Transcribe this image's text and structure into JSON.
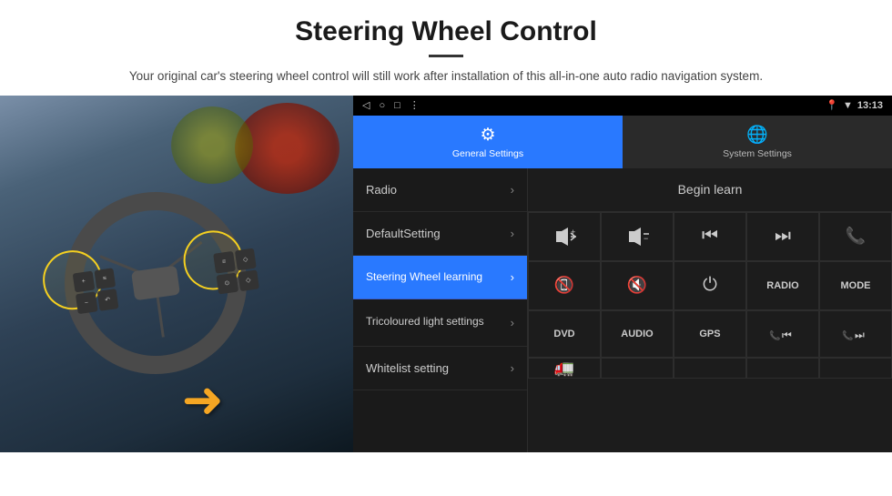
{
  "header": {
    "title": "Steering Wheel Control",
    "subtitle": "Your original car's steering wheel control will still work after installation of this all-in-one auto radio navigation system."
  },
  "status_bar": {
    "location_icon": "📍",
    "wifi_icon": "▼",
    "time": "13:13",
    "nav_back": "◁",
    "nav_home": "○",
    "nav_square": "□",
    "nav_dots": "⋮"
  },
  "tabs": [
    {
      "id": "general",
      "label": "General Settings",
      "icon": "⚙",
      "active": true
    },
    {
      "id": "system",
      "label": "System Settings",
      "icon": "🌐",
      "active": false
    }
  ],
  "menu_items": [
    {
      "id": "radio",
      "label": "Radio",
      "active": false
    },
    {
      "id": "default",
      "label": "DefaultSetting",
      "active": false
    },
    {
      "id": "steering",
      "label": "Steering Wheel learning",
      "active": true
    },
    {
      "id": "tricolour",
      "label": "Tricoloured light settings",
      "active": false
    },
    {
      "id": "whitelist",
      "label": "Whitelist setting",
      "active": false
    }
  ],
  "right_panel": {
    "begin_learn_label": "Begin learn",
    "controls": [
      {
        "id": "vol_up",
        "symbol": "🔊+",
        "type": "icon"
      },
      {
        "id": "vol_down",
        "symbol": "🔈-",
        "type": "icon"
      },
      {
        "id": "prev",
        "symbol": "⏮",
        "type": "icon"
      },
      {
        "id": "next",
        "symbol": "⏭",
        "type": "icon"
      },
      {
        "id": "phone",
        "symbol": "📞",
        "type": "icon"
      },
      {
        "id": "hang_up",
        "symbol": "📵",
        "type": "icon"
      },
      {
        "id": "mute",
        "symbol": "🔇",
        "type": "icon"
      },
      {
        "id": "power",
        "symbol": "⏻",
        "type": "icon"
      },
      {
        "id": "radio_btn",
        "symbol": "RADIO",
        "type": "text"
      },
      {
        "id": "mode_btn",
        "symbol": "MODE",
        "type": "text"
      }
    ],
    "bottom_row": [
      {
        "id": "dvd",
        "symbol": "DVD"
      },
      {
        "id": "audio",
        "symbol": "AUDIO"
      },
      {
        "id": "gps",
        "symbol": "GPS"
      },
      {
        "id": "phone_prev",
        "symbol": "📞⏮"
      },
      {
        "id": "phone_next",
        "symbol": "📞⏭"
      }
    ],
    "icon_row_bottom": [
      {
        "id": "truck_icon",
        "symbol": "🚛"
      }
    ]
  }
}
